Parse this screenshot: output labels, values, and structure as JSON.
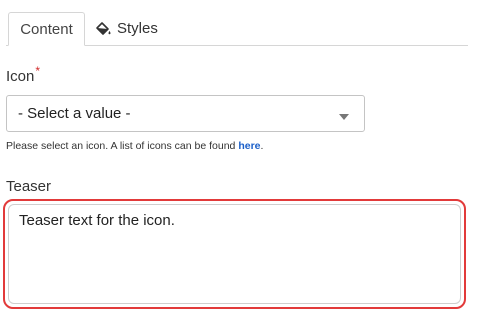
{
  "tabs": {
    "content_label": "Content",
    "styles_label": "Styles"
  },
  "icon_field": {
    "label": "Icon",
    "required_marker": "*",
    "selected_value": "- Select a value -",
    "help_text": "Please select an icon. A list of icons can be found ",
    "help_link": "here",
    "help_suffix": "."
  },
  "teaser_field": {
    "label": "Teaser",
    "value": "Teaser text for the icon."
  },
  "colors": {
    "required": "#d12b2b",
    "link": "#1b5fc9",
    "highlight_border": "#e23a3a"
  }
}
